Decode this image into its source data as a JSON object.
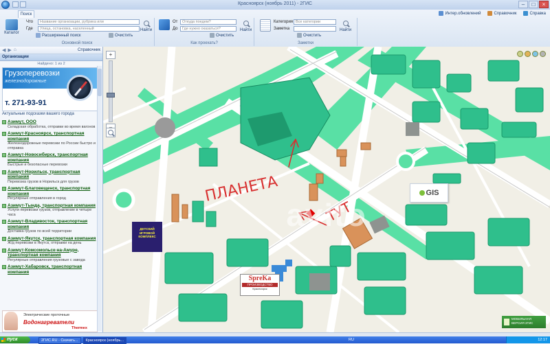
{
  "window": {
    "title": "Красноярск (ноябрь 2011) - 2ГИС",
    "buttons": [
      "–",
      "□",
      "×"
    ]
  },
  "ribbon": {
    "tab": "Поиск",
    "top_links": [
      {
        "label": "Интер.обновлений",
        "icon": "update-icon"
      },
      {
        "label": "Справочник",
        "icon": "directory-icon"
      },
      {
        "label": "Справка",
        "icon": "help-icon"
      }
    ],
    "groups": {
      "basic_search": {
        "title": "Основной поиск",
        "catalog_label": "Каталог",
        "what_label": "Что",
        "where_label": "Где",
        "what_placeholder": "Название организации, рубрика или",
        "where_placeholder": "Улица, остановка, населенный",
        "advanced_label": "Расширенный поиск",
        "clear_label": "Очистить",
        "find_label": "Найти"
      },
      "route": {
        "title": "Как проехать?",
        "from_label": "От",
        "to_label": "До",
        "from_placeholder": "Откуда поедем?",
        "to_placeholder": "Где нужно оказаться?",
        "clear_label": "Очистить",
        "find_label": "Найти"
      },
      "notes": {
        "title": "Заметки",
        "category_label": "Категория",
        "notes_label": "Заметка",
        "category_value": "Все категории",
        "clear_label": "Очистить",
        "find_label": "Найти"
      }
    }
  },
  "left": {
    "nav_label": "Справочник",
    "header": "Организации",
    "pager": "Найдено: 1 из 2",
    "ad": {
      "title": "Грузоперевозки",
      "subtitle": "железнодорожные",
      "phone": "т. 271-93-91"
    },
    "subtitle": "Актуальные подсказки вашего города",
    "orgs": [
      {
        "name": "Азимут, ООО",
        "desc": "Складская обработка, отправки во время вагонов"
      },
      {
        "name": "Азимут-Красноярск, транспортная компания",
        "desc": "Железнодорожные перевозки по России быстро и отправка"
      },
      {
        "name": "Азимут-Новосибирск, транспортная компания",
        "desc": "Быстрые и безопасные перевозки"
      },
      {
        "name": "Азимут-Норильск, транспортная компания",
        "desc": "Перевозка грузов в Норильск для грузов"
      },
      {
        "name": "Азимут-Благовещенск, транспортная компания",
        "desc": "Регулярные отправления в город"
      },
      {
        "name": "Азимут-Тында, транспортная компания",
        "desc": "Услуги перевозки грузов, отправление в четыре часа"
      },
      {
        "name": "Азимут-Владивосток, транспортная компания",
        "desc": "Доставка грузов по всей территории"
      },
      {
        "name": "Азимут-Якутск, транспортная компания",
        "desc": "Ж/д перевозки в Якутск, отправки на день"
      },
      {
        "name": "Азимут-Комсомольск-на-Амуре, транспортная компания",
        "desc": "Регулярные отправления грузовые с завода"
      },
      {
        "name": "Азимут-Хабаровск, транспортная компания",
        "desc": ""
      }
    ],
    "ad2": {
      "line1": "Электрические проточные",
      "line2": "Водонагреватели",
      "brand": "Thermex"
    }
  },
  "map": {
    "handwriting": [
      "ПЛАНЕТА",
      "ТУТ"
    ],
    "dgis_label": "GIS",
    "spreka": {
      "title": "SpreKa",
      "line1": "ПРОИЗВОДСТВО",
      "line2": "Красноярск"
    },
    "complex_label": "ДЕТСКИЙ ИГРОВОЙ КОМПЛЕКС",
    "promo": "МОБИЛЬНАЯ ВЕРСИЯ 2ГИС",
    "watermark": "avito",
    "marker_color": "#e00000",
    "zoom_in": "+",
    "zoom_out": "–"
  },
  "taskbar": {
    "start": "пуск",
    "tasks": [
      "2ГИС.RU - Скачать...",
      "Красноярск (ноябрь..."
    ],
    "lang": "RU",
    "clock": "12:17"
  },
  "colors": {
    "building": "#2fbf8c",
    "green": "#59e0a5",
    "road": "#ffffff",
    "ground": "#f1efe6"
  }
}
